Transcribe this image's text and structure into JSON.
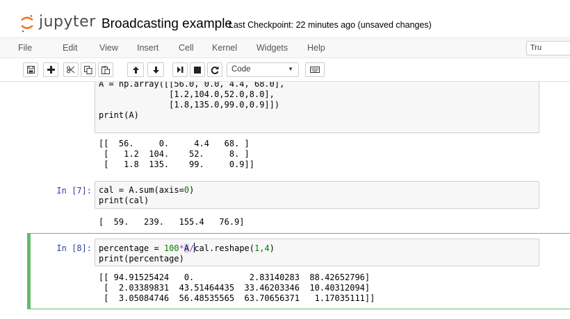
{
  "header": {
    "logo_text": "jupyter",
    "notebook_title": "Broadcasting example",
    "checkpoint": "Last Checkpoint: 22 minutes ago (unsaved changes)"
  },
  "menubar": {
    "items": [
      "File",
      "Edit",
      "View",
      "Insert",
      "Cell",
      "Kernel",
      "Widgets",
      "Help"
    ],
    "trusted_label": "Tru"
  },
  "toolbar": {
    "buttons": [
      "save-icon",
      "plus-icon",
      "cut-icon",
      "copy-icon",
      "paste-icon",
      "arrow-up-icon",
      "arrow-down-icon",
      "run-icon",
      "stop-icon",
      "restart-icon",
      "keyboard-icon"
    ],
    "cell_type": "Code"
  },
  "cells": {
    "cell1": {
      "code_lines": [
        "A = np.array([[56.0, 0.0, 4.4, 68.0],",
        "              [1.2,104.0,52.0,8.0],",
        "              [1.8,135.0,99.0,0.9]])",
        "",
        "print(A)"
      ],
      "output": "[[  56.     0.     4.4   68. ]\n [   1.2  104.    52.     8. ]\n [   1.8  135.    99.     0.9]]"
    },
    "cell2": {
      "prompt": "In [7]:",
      "code_line1_a": "cal = A.sum(axis=",
      "code_line1_num": "0",
      "code_line1_b": ")",
      "code_line2": "print(cal)",
      "output": "[  59.   239.   155.4   76.9]"
    },
    "cell3": {
      "prompt": "In [8]:",
      "code_line1_a": "percentage = ",
      "code_line1_num": "100",
      "code_line1_op": "*",
      "code_line1_b": "A",
      "code_line1_op2": "/",
      "code_line1_c": "cal.reshape(",
      "code_line1_args": "1,4",
      "code_line1_d": ")",
      "code_line2": "print(percentage)",
      "output": "[[ 94.91525424   0.           2.83140283  88.42652796]\n [  2.03389831  43.51464435  33.46203346  10.40312094]\n [  3.05084746  56.48535565  63.70656371   1.17035111]]"
    }
  },
  "colors": {
    "prompt": "#303f9f",
    "selected_border": "#66bb6a",
    "logo_orange": "#f37726",
    "number_green": "#008000"
  }
}
